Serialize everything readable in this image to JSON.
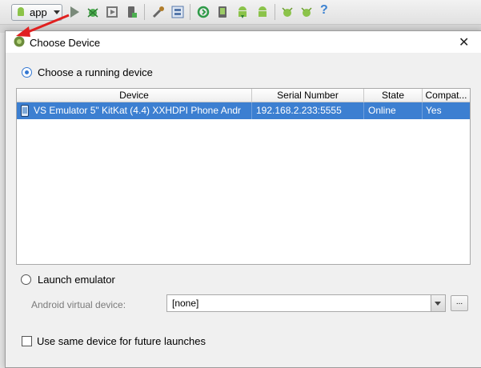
{
  "toolbar": {
    "run_config": "app",
    "help_glyph": "?",
    "icons": [
      "android-icon",
      "run-icon",
      "debug-icon",
      "coverage-icon",
      "stop-icon",
      "settings-icon",
      "structure-icon",
      "sync-icon",
      "avd-manager-icon",
      "sdk-manager-icon",
      "android-monitor-icon",
      "android-icon",
      "debug-android-icon",
      "help-icon"
    ]
  },
  "dialog": {
    "title": "Choose Device",
    "close_glyph": "✕",
    "running_option_label": "Choose a running device",
    "table": {
      "columns": [
        "Device",
        "Serial Number",
        "State",
        "Compat..."
      ],
      "rows": [
        {
          "device": "VS Emulator 5\" KitKat (4.4) XXHDPI Phone Andr",
          "serial": "192.168.2.233:5555",
          "state": "Online",
          "compat": "Yes"
        }
      ]
    },
    "launch_option_label": "Launch emulator",
    "avd_label": "Android virtual device:",
    "avd_value": "[none]",
    "browse_glyph": "...",
    "same_device_label": "Use same device for future launches"
  },
  "colors": {
    "selection": "#3c7fd1",
    "annotation_arrow": "#e02020",
    "radio_accent": "#3478d2"
  }
}
